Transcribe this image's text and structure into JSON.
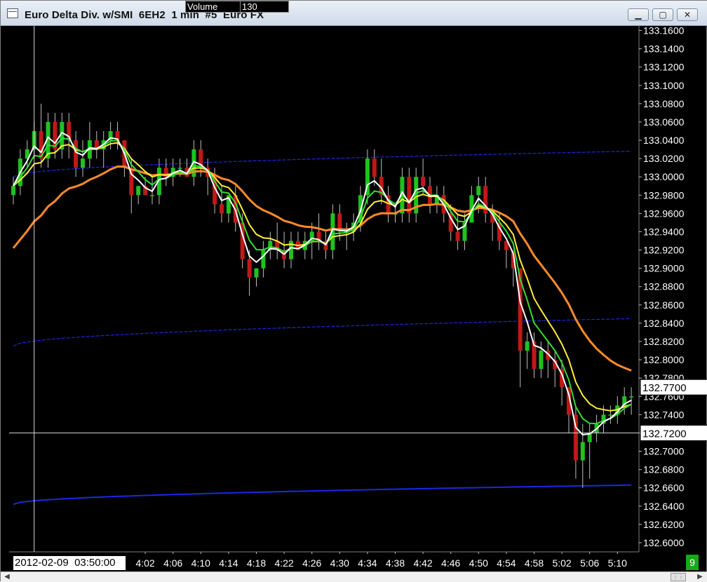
{
  "window": {
    "title": "Euro Delta Div. w/SMI  6EH2  1 min  #5  Euro FX",
    "minimize_label": "▁",
    "maximize_label": "▢",
    "close_label": "✕"
  },
  "data_box": {
    "label": "Volume",
    "value": "130"
  },
  "cursor": {
    "date_time": "2012-02-09  03:50:00",
    "price_label": "132.7200",
    "price": 132.72,
    "time_index": 3
  },
  "current_price": {
    "label": "132.7700",
    "price": 132.77
  },
  "bars_badge": "9",
  "colors": {
    "background": "#000000",
    "up_candle": "#1fc21f",
    "down_candle": "#c01818",
    "wick": "#bfbfbf",
    "ema_fast": "#ffffff",
    "ema_mid": "#33dd33",
    "ema_slow": "#ffee33",
    "ema_long": "#ff8a2a",
    "band": "#1a28e6",
    "axis_text": "#ffffff",
    "crosshair": "#d8d8d8"
  },
  "chart_data": {
    "type": "candlestick",
    "y_range": [
      132.59,
      133.165
    ],
    "y_ticks": [
      "133.1600",
      "133.1400",
      "133.1200",
      "133.1000",
      "133.0800",
      "133.0600",
      "133.0400",
      "133.0200",
      "133.0000",
      "132.9800",
      "132.9600",
      "132.9400",
      "132.9200",
      "132.9000",
      "132.8800",
      "132.8600",
      "132.8400",
      "132.8200",
      "132.8000",
      "132.7800",
      "132.7600",
      "132.7400",
      "132.7200",
      "132.7000",
      "132.6800",
      "132.6600",
      "132.6400",
      "132.6200",
      "132.6000"
    ],
    "x_tick_labels": [
      "4:02",
      "4:06",
      "4:10",
      "4:14",
      "4:18",
      "4:22",
      "4:26",
      "4:30",
      "4:34",
      "4:38",
      "4:42",
      "4:46",
      "4:50",
      "4:54",
      "4:58",
      "5:02",
      "5:06",
      "5:10"
    ],
    "x_tick_start_index": 19,
    "x_tick_every": 4,
    "candles": [
      [
        132.98,
        133.0,
        132.97,
        132.99
      ],
      [
        132.99,
        133.03,
        132.98,
        133.02
      ],
      [
        133.02,
        133.04,
        133.01,
        133.03
      ],
      [
        133.03,
        133.06,
        133.02,
        133.05
      ],
      [
        133.05,
        133.08,
        133.01,
        133.02
      ],
      [
        133.02,
        133.07,
        133.01,
        133.06
      ],
      [
        133.06,
        133.07,
        133.02,
        133.03
      ],
      [
        133.03,
        133.07,
        133.02,
        133.06
      ],
      [
        133.06,
        133.07,
        133.02,
        133.04
      ],
      [
        133.04,
        133.05,
        133.0,
        133.01
      ],
      [
        133.01,
        133.04,
        133.0,
        133.02
      ],
      [
        133.02,
        133.06,
        133.01,
        133.04
      ],
      [
        133.04,
        133.05,
        133.02,
        133.03
      ],
      [
        133.03,
        133.05,
        133.01,
        133.04
      ],
      [
        133.04,
        133.06,
        133.03,
        133.05
      ],
      [
        133.05,
        133.06,
        133.03,
        133.04
      ],
      [
        133.04,
        133.04,
        133.0,
        133.01
      ],
      [
        133.01,
        133.02,
        132.96,
        132.98
      ],
      [
        132.98,
        132.99,
        132.97,
        132.99
      ],
      [
        132.99,
        133.0,
        132.98,
        132.98
      ],
      [
        132.98,
        133.0,
        132.97,
        132.98
      ],
      [
        132.98,
        133.02,
        132.97,
        133.01
      ],
      [
        133.01,
        133.02,
        132.99,
        133.0
      ],
      [
        133.0,
        133.02,
        132.99,
        133.01
      ],
      [
        133.01,
        133.02,
        133.0,
        133.01
      ],
      [
        133.01,
        133.02,
        133.0,
        133.0
      ],
      [
        133.0,
        133.04,
        132.99,
        133.03
      ],
      [
        133.03,
        133.04,
        133.0,
        133.01
      ],
      [
        133.01,
        133.02,
        132.98,
        133.0
      ],
      [
        133.0,
        133.01,
        132.96,
        132.97
      ],
      [
        132.97,
        132.99,
        132.95,
        132.96
      ],
      [
        132.96,
        132.98,
        132.95,
        132.98
      ],
      [
        132.98,
        132.99,
        132.94,
        132.95
      ],
      [
        132.95,
        132.96,
        132.9,
        132.91
      ],
      [
        132.91,
        132.92,
        132.87,
        132.89
      ],
      [
        132.89,
        132.9,
        132.88,
        132.9
      ],
      [
        132.9,
        132.93,
        132.89,
        132.92
      ],
      [
        132.92,
        132.94,
        132.91,
        132.93
      ],
      [
        132.93,
        132.95,
        132.91,
        132.92
      ],
      [
        132.92,
        132.94,
        132.9,
        132.91
      ],
      [
        132.91,
        132.94,
        132.9,
        132.93
      ],
      [
        132.93,
        132.94,
        132.92,
        132.92
      ],
      [
        132.92,
        132.94,
        132.91,
        132.93
      ],
      [
        132.93,
        132.95,
        132.91,
        132.94
      ],
      [
        132.94,
        132.96,
        132.92,
        132.93
      ],
      [
        132.93,
        132.94,
        132.91,
        132.92
      ],
      [
        132.92,
        132.97,
        132.91,
        132.96
      ],
      [
        132.96,
        132.97,
        132.93,
        132.94
      ],
      [
        132.94,
        132.95,
        132.92,
        132.94
      ],
      [
        132.94,
        132.96,
        132.93,
        132.95
      ],
      [
        132.95,
        132.99,
        132.94,
        132.98
      ],
      [
        132.98,
        133.03,
        132.97,
        133.02
      ],
      [
        133.02,
        133.03,
        132.99,
        133.0
      ],
      [
        133.0,
        133.02,
        132.97,
        132.98
      ],
      [
        132.98,
        132.99,
        132.95,
        132.96
      ],
      [
        132.96,
        132.97,
        132.95,
        132.96
      ],
      [
        132.96,
        133.01,
        132.95,
        133.0
      ],
      [
        133.0,
        133.01,
        132.95,
        132.96
      ],
      [
        132.96,
        133.01,
        132.95,
        133.0
      ],
      [
        133.0,
        133.02,
        132.98,
        132.99
      ],
      [
        132.99,
        133.0,
        132.96,
        132.97
      ],
      [
        132.97,
        132.99,
        132.96,
        132.98
      ],
      [
        132.98,
        132.99,
        132.95,
        132.96
      ],
      [
        132.96,
        132.97,
        132.93,
        132.94
      ],
      [
        132.94,
        132.96,
        132.92,
        132.93
      ],
      [
        132.93,
        132.96,
        132.92,
        132.95
      ],
      [
        132.95,
        132.99,
        132.95,
        132.98
      ],
      [
        132.98,
        133.0,
        132.96,
        132.99
      ],
      [
        132.99,
        133.0,
        132.95,
        132.96
      ],
      [
        132.96,
        132.97,
        132.93,
        132.95
      ],
      [
        132.95,
        132.96,
        132.92,
        132.93
      ],
      [
        132.93,
        132.93,
        132.9,
        132.92
      ],
      [
        132.92,
        132.92,
        132.88,
        132.9
      ],
      [
        132.9,
        132.9,
        132.77,
        132.81
      ],
      [
        132.81,
        132.83,
        132.79,
        132.82
      ],
      [
        132.82,
        132.83,
        132.78,
        132.79
      ],
      [
        132.79,
        132.82,
        132.78,
        132.81
      ],
      [
        132.81,
        132.82,
        132.78,
        132.8
      ],
      [
        132.8,
        132.81,
        132.77,
        132.79
      ],
      [
        132.79,
        132.8,
        132.75,
        132.77
      ],
      [
        132.77,
        132.77,
        132.72,
        132.74
      ],
      [
        132.74,
        132.75,
        132.67,
        132.69
      ],
      [
        132.69,
        132.73,
        132.66,
        132.71
      ],
      [
        132.71,
        132.73,
        132.67,
        132.72
      ],
      [
        132.72,
        132.74,
        132.71,
        132.73
      ],
      [
        132.73,
        132.75,
        132.72,
        132.74
      ],
      [
        132.74,
        132.75,
        132.73,
        132.74
      ],
      [
        132.74,
        132.76,
        132.73,
        132.75
      ],
      [
        132.75,
        132.77,
        132.74,
        132.76
      ],
      [
        132.76,
        132.77,
        132.74,
        132.76
      ]
    ],
    "indicators": {
      "ema_fast_period": 3,
      "ema_mid_period": 5,
      "ema_slow_period": 8,
      "ema_long_period": 20,
      "ema_long_seed": 132.915,
      "band_upper_start": 133.0,
      "band_upper_end": 133.028,
      "band_middle_start": 132.815,
      "band_middle_end": 132.845,
      "band_lower_start": 132.642,
      "band_lower_end": 132.663
    }
  }
}
